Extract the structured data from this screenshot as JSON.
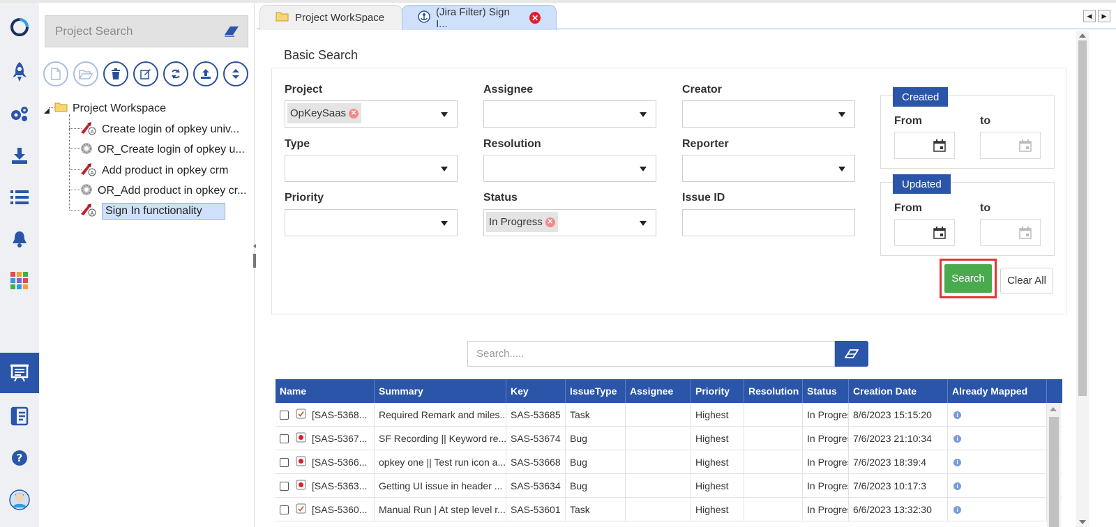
{
  "project_tree": {
    "search_placeholder": "Project Search",
    "root_label": "Project Workspace",
    "items": [
      {
        "label": "Create login of opkey univ...",
        "type": "testcase"
      },
      {
        "label": "OR_Create login of opkey u...",
        "type": "object-repository"
      },
      {
        "label": "Add product in opkey crm",
        "type": "testcase"
      },
      {
        "label": "OR_Add product in opkey cr...",
        "type": "object-repository"
      },
      {
        "label": "Sign In functionality",
        "type": "testcase",
        "selected": true
      }
    ]
  },
  "tabs": [
    {
      "label": "Project WorkSpace",
      "active": false
    },
    {
      "label": "(Jira Filter) Sign I...",
      "active": true
    }
  ],
  "basic_search": {
    "title": "Basic Search",
    "fields": {
      "project": {
        "label": "Project",
        "chip": "OpKeySaas"
      },
      "assignee": {
        "label": "Assignee"
      },
      "creator": {
        "label": "Creator"
      },
      "type": {
        "label": "Type"
      },
      "resolution": {
        "label": "Resolution"
      },
      "reporter": {
        "label": "Reporter"
      },
      "priority": {
        "label": "Priority"
      },
      "status": {
        "label": "Status",
        "chip": "In Progress"
      },
      "issue_id": {
        "label": "Issue ID"
      }
    },
    "created": {
      "legend": "Created",
      "from": "From",
      "to": "to"
    },
    "updated": {
      "legend": "Updated",
      "from": "From",
      "to": "to"
    },
    "search_label": "Search",
    "clear_label": "Clear All"
  },
  "results": {
    "search_placeholder": "Search.....",
    "columns": [
      "Name",
      "Summary",
      "Key",
      "IssueType",
      "Assignee",
      "Priority",
      "Resolution",
      "Status",
      "Creation Date",
      "Already Mapped"
    ],
    "rows": [
      {
        "name": "[SAS-5368...",
        "summary": "Required Remark and miles...",
        "key": "SAS-53685",
        "issue_type": "Task",
        "assignee": "",
        "priority": "Highest",
        "resolution": "",
        "status": "In Progres",
        "creation_date": "8/6/2023 15:15:20"
      },
      {
        "name": "[SAS-5367...",
        "summary": "SF Recording || Keyword re...",
        "key": "SAS-53674",
        "issue_type": "Bug",
        "assignee": "",
        "priority": "Highest",
        "resolution": "",
        "status": "In Progres",
        "creation_date": "7/6/2023 21:10:34"
      },
      {
        "name": "[SAS-5366...",
        "summary": "opkey one || Test run icon a...",
        "key": "SAS-53668",
        "issue_type": "Bug",
        "assignee": "",
        "priority": "Highest",
        "resolution": "",
        "status": "In Progres",
        "creation_date": "7/6/2023 18:39:4"
      },
      {
        "name": "[SAS-5363...",
        "summary": "Getting UI issue in header ...",
        "key": "SAS-53634",
        "issue_type": "Bug",
        "assignee": "",
        "priority": "Highest",
        "resolution": "",
        "status": "In Progres",
        "creation_date": "7/6/2023 10:17:3"
      },
      {
        "name": "[SAS-5360...",
        "summary": "Manual Run | At step level r...",
        "key": "SAS-53601",
        "issue_type": "Task",
        "assignee": "",
        "priority": "Highest",
        "resolution": "",
        "status": "In Progres",
        "creation_date": "6/6/2023 13:32:30"
      }
    ]
  },
  "colors": {
    "primary": "#2a55a8",
    "success": "#4aaa4e",
    "highlight": "#e03535",
    "rail_bg": "#eef0f4"
  },
  "icons": {
    "rail": [
      "opkey-logo-icon",
      "rocket-icon",
      "gears-icon",
      "download-icon",
      "list-icon",
      "bell-icon",
      "apps-grid-icon",
      "presentation-icon",
      "reports-icon",
      "help-icon",
      "user-avatar-icon"
    ]
  }
}
